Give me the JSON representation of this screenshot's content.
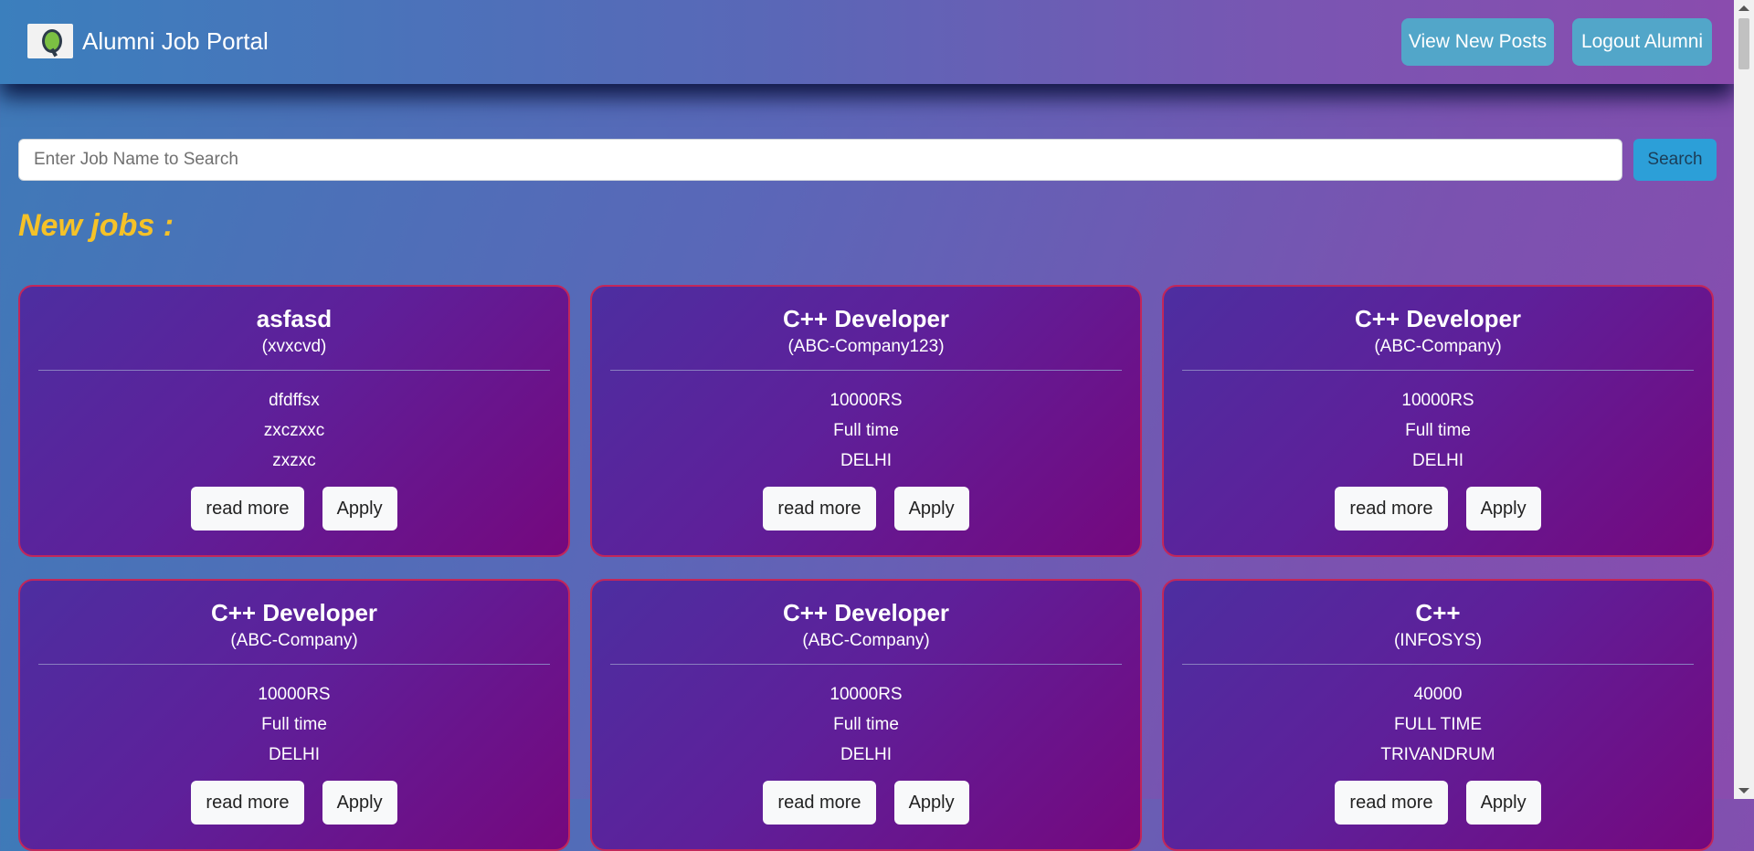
{
  "header": {
    "brand_title": "Alumni Job Portal",
    "buttons": {
      "view_new_posts": "View New Posts",
      "logout": "Logout Alumni"
    }
  },
  "search": {
    "placeholder": "Enter Job Name to Search",
    "value": "",
    "button_label": "Search"
  },
  "section_title": "New jobs :",
  "jobs": [
    {
      "title": "asfasd",
      "company": "(xvxcvd)",
      "salary": "dfdffsx",
      "type": "zxczxxc",
      "location": "zxzxc",
      "read_more": "read more",
      "apply": "Apply"
    },
    {
      "title": "C++ Developer",
      "company": "(ABC-Company123)",
      "salary": "10000RS",
      "type": "Full time",
      "location": "DELHI",
      "read_more": "read more",
      "apply": "Apply"
    },
    {
      "title": "C++ Developer",
      "company": "(ABC-Company)",
      "salary": "10000RS",
      "type": "Full time",
      "location": "DELHI",
      "read_more": "read more",
      "apply": "Apply"
    },
    {
      "title": "C++ Developer",
      "company": "(ABC-Company)",
      "salary": "10000RS",
      "type": "Full time",
      "location": "DELHI",
      "read_more": "read more",
      "apply": "Apply"
    },
    {
      "title": "C++ Developer",
      "company": "(ABC-Company)",
      "salary": "10000RS",
      "type": "Full time",
      "location": "DELHI",
      "read_more": "read more",
      "apply": "Apply"
    },
    {
      "title": "C++",
      "company": "(INFOSYS)",
      "salary": "40000",
      "type": "FULL TIME",
      "location": "TRIVANDRUM",
      "read_more": "read more",
      "apply": "Apply"
    }
  ],
  "colors": {
    "section_title": "#f5c228",
    "card_border": "#c2275a",
    "search_button": "#2c9fd8",
    "nav_button": "#52a6c9"
  }
}
